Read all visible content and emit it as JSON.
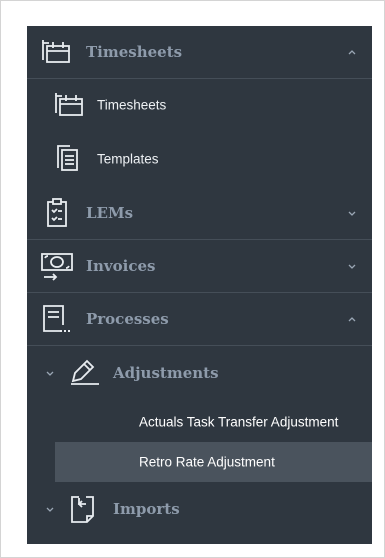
{
  "sidebar": {
    "timesheets_section": {
      "label": "Timesheets",
      "icon": "timesheet-icon",
      "expanded": true
    },
    "timesheets_items": [
      {
        "label": "Timesheets",
        "icon": "timesheet-icon"
      },
      {
        "label": "Templates",
        "icon": "templates-icon"
      }
    ],
    "lems_section": {
      "label": "LEMs",
      "icon": "clipboard-checklist-icon",
      "expanded": false
    },
    "invoices_section": {
      "label": "Invoices",
      "icon": "invoice-money-icon",
      "expanded": false
    },
    "processes_section": {
      "label": "Processes",
      "icon": "processes-document-icon",
      "expanded": true
    },
    "adjustments_group": {
      "label": "Adjustments",
      "icon": "pen-edit-icon",
      "expanded": true,
      "items": [
        {
          "label": "Actuals Task Transfer Adjustment",
          "selected": false
        },
        {
          "label": "Retro Rate Adjustment",
          "selected": true
        }
      ]
    },
    "imports_group": {
      "label": "Imports",
      "icon": "import-file-icon",
      "expanded": true
    }
  },
  "colors": {
    "sidebar_bg": "#2f3740",
    "section_text": "#8e9bab",
    "item_text": "#ffffff",
    "selected_bg": "#4a535d",
    "divider": "#454e58"
  }
}
